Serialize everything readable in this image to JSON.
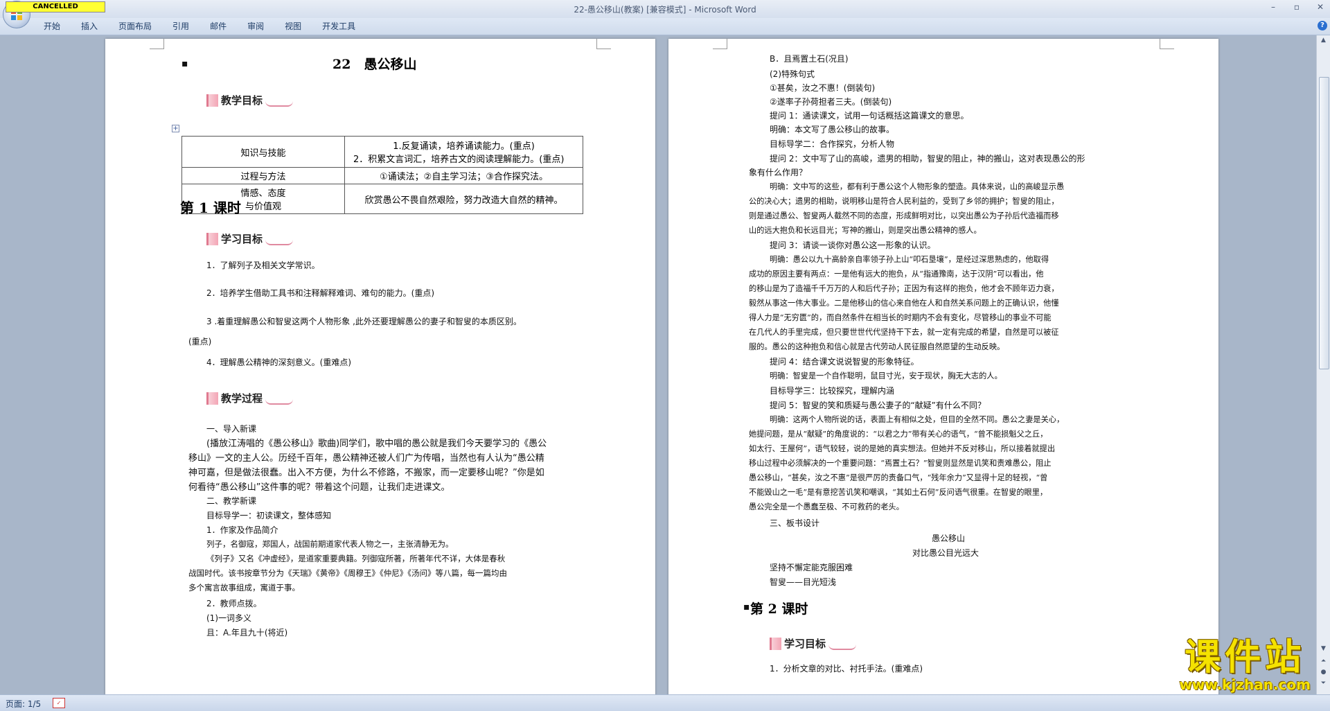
{
  "window": {
    "title": "22-愚公移山(教案) [兼容模式] - Microsoft Word",
    "cancel_badge": "CANCELLED",
    "minimize": "–",
    "maximize": "▫",
    "close": "✕"
  },
  "ribbon": {
    "tabs": [
      "开始",
      "插入",
      "页面布局",
      "引用",
      "邮件",
      "审阅",
      "视图",
      "开发工具"
    ],
    "help": "?"
  },
  "left_page": {
    "title": "22　愚公移山",
    "teaching_goals_header": "教学目标",
    "goals_table": [
      {
        "key": "知识与技能",
        "value_line1": "1.反复诵读，培养诵读能力。(重点)",
        "value_line2": "2．积累文言词汇，培养古文的阅读理解能力。(重点)"
      },
      {
        "key": "过程与方法",
        "value_line1": "①诵读法；②自主学习法；③合作探究法。"
      },
      {
        "key_line1": "情感、态度",
        "key_line2": "与价值观",
        "value_line1": "欣赏愚公不畏自然艰险，努力改造大自然的精神。"
      }
    ],
    "lesson1": "第 1 课时",
    "study_goals_header": "学习目标",
    "study_goals": [
      "1．了解列子及相关文学常识。",
      "2．培养学生借助工具书和注释解释难词、难句的能力。(重点)",
      "3 .着重理解愚公和智叟这两个人物形象 ,此外还要理解愚公的妻子和智叟的本质区别。",
      "(重点)",
      "4．理解愚公精神的深刻意义。(重难点)"
    ],
    "process_header": "教学过程",
    "process": [
      "一、导入新课",
      "(播放江涛唱的《愚公移山》歌曲)同学们，歌中唱的愚公就是我们今天要学习的《愚公",
      "移山》一文的主人公。历经千百年，愚公精神还被人们广为传唱，当然也有人认为“愚公精",
      "神可嘉，但是做法很蠢。出入不方便，为什么不修路，不搬家，而一定要移山呢？”你是如",
      "何看待“愚公移山”这件事的呢？带着这个问题，让我们走进课文。",
      "二、教学新课",
      "目标导学一：初读课文，整体感知",
      "1．作家及作品简介",
      "列子，名御寇，郑国人，战国前期道家代表人物之一，主张清静无为。",
      "《列子》又名《冲虚经》，是道家重要典籍。列御寇所著，所著年代不详，大体是春秋",
      "战国时代。该书按章节分为《天瑞》《黄帝》《周穆王》《仲尼》《汤问》等八篇，每一篇均由",
      "多个寓言故事组成，寓道于事。",
      "2．教师点拨。",
      "(1)一词多义",
      "且：A.年且九十(将近)"
    ]
  },
  "right_page": {
    "lines": [
      "B．且焉置土石(况且)",
      "(2)特殊句式",
      "①甚矣，汝之不惠！(倒装句)",
      "②遂率子孙荷担者三夫。(倒装句)",
      "提问 1：通读课文，试用一句话概括这篇课文的意思。",
      "明确：本文写了愚公移山的故事。",
      "目标导学二：合作探究，分析人物",
      "提问 2：文中写了山的高峻，遗男的相助，智叟的阻止，神的搬山，这对表现愚公的形",
      "象有什么作用？",
      "明确：文中写的这些，都有利于愚公这个人物形象的塑造。具体来说，山的高峻显示愚",
      "公的决心大；遗男的相助，说明移山是符合人民利益的，受到了乡邻的拥护；智叟的阻止，",
      "则是通过愚公、智叟两人截然不同的态度，形成鲜明对比，以突出愚公为子孙后代造福而移",
      "山的远大抱负和长远目光；写神的搬山，则是突出愚公精神的感人。",
      "提问 3：请谈一谈你对愚公这一形象的认识。",
      "明确：愚公以九十高龄亲自率领子孙上山“叩石垦壤”，是经过深思熟虑的，他取得",
      "成功的原因主要有两点：一是他有远大的抱负，从“指通豫南，达于汉阴”可以看出，他",
      "的移山是为了造福千千万万的人和后代子孙；正因为有这样的抱负，他才会不顾年迈力衰，",
      "毅然从事这一伟大事业。二是他移山的信心来自他在人和自然关系问题上的正确认识，他懂",
      "得人力是“无穷匮”的，而自然条件在相当长的时期内不会有变化，尽管移山的事业不可能",
      "在几代人的手里完成，但只要世世代代坚持干下去，就一定有完成的希望，自然是可以被征",
      "服的。愚公的这种抱负和信心就是古代劳动人民征服自然愿望的生动反映。",
      "提问 4：结合课文说说智叟的形象特征。",
      "明确：智叟是一个自作聪明，鼠目寸光，安于现状，胸无大志的人。",
      "目标导学三：比较探究，理解内涵",
      "提问 5：智叟的笑和质疑与愚公妻子的“献疑”有什么不同？",
      "明确：这两个人物所说的话，表面上有相似之处，但目的全然不同。愚公之妻是关心，",
      "她提问题，是从“献疑”的角度说的：“以君之力”带有关心的语气，“曾不能损魁父之丘，",
      "如太行、王屋何”，语气较轻，说的是她的真实想法。但她并不反对移山，所以接着就提出",
      "移山过程中必须解决的一个重要问题：“焉置土石？”智叟则显然是讥笑和责难愚公，阻止",
      "愚公移山，“甚矣，汝之不惠”是很严厉的责备口气，“残年余力”又显得十足的轻视，“曾",
      "不能毁山之一毛”是有意挖苦讥笑和嘲讽，“其如土石何”反问语气很重。在智叟的眼里，",
      "愚公完全是一个愚蠢至极、不可救药的老头。",
      "三、板书设计"
    ],
    "board_line1": "愚公移山",
    "board_line2": "对比愚公目光远大",
    "board_line3": "坚持不懈定能克服困难",
    "board_line4": "智叟——目光短浅",
    "lesson2": "第 2 课时",
    "study_goals_header": "学习目标",
    "last_line": "1．分析文章的对比、衬托手法。(重难点)"
  },
  "statusbar": {
    "page": "页面: 1/5"
  },
  "watermark": {
    "big": "课件站",
    "url": "www.kjzhan.com"
  }
}
